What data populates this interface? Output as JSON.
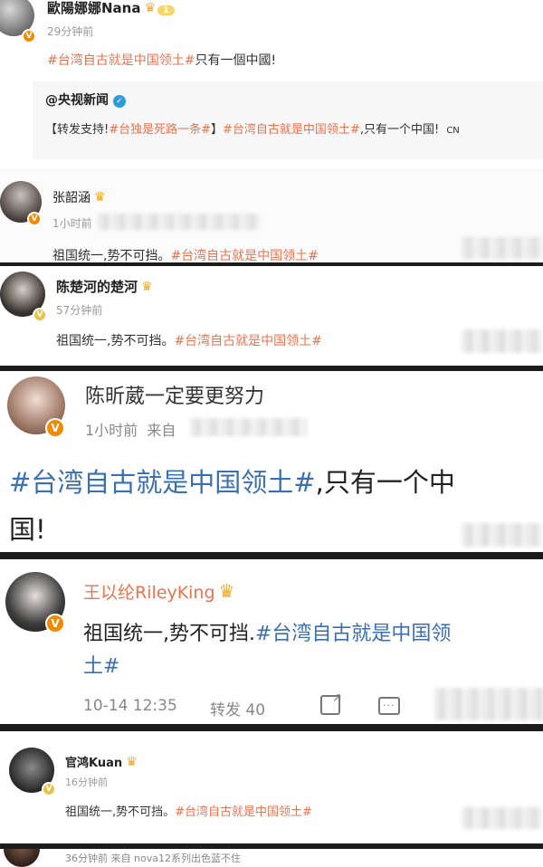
{
  "posts": [
    {
      "name": "歐陽娜娜Nana",
      "level": "1",
      "time": "29分钟前",
      "tag": "#台湾自古就是中国领土#",
      "text": "只有一個中國!",
      "quote": {
        "author": "@央视新闻",
        "prefix": "【转发支持!",
        "tag1": "#台独是死路一条#",
        "suffix": "】",
        "tag2": "#台湾自古就是中国领土#",
        "text": ",只有一个中国!",
        "flag": "CN"
      }
    },
    {
      "name": "张韶涵",
      "time": "1小时前",
      "text": "祖国统一,势不可挡。",
      "tag": "#台湾自古就是中国领土#"
    },
    {
      "name": "陈楚河的楚河",
      "time": "57分钟前",
      "text": "祖国统一,势不可挡。",
      "tag": "#台湾自古就是中国领土#"
    },
    {
      "name": "陈昕葳一定要更努力",
      "time": "1小时前",
      "source_prefix": "来自",
      "tag": "#台湾自古就是中国领土#",
      "text_line1": ",只有一个中",
      "text_line2": "国!"
    },
    {
      "name": "王以纶RileyKing",
      "text": "祖国统一,势不可挡.",
      "tag_line1": "#台湾自古就是中国领",
      "tag_line2": "土#",
      "date": "10-14 12:35",
      "repost_label": "转发",
      "repost_count": "40"
    },
    {
      "name": "官鸿Kuan",
      "time": "16分钟前",
      "text": "祖国统一,势不可挡。",
      "tag": "#台湾自古就是中国领土#"
    },
    {
      "meta": "36分钟前  来自 nova12系列出色蓝不住"
    }
  ],
  "icons": {
    "verified": "v-badge-icon",
    "crown": "crown-icon",
    "share": "share-icon",
    "comment": "comment-icon"
  },
  "colors": {
    "tag_orange": "#eb7350",
    "tag_blue": "#3a6fb0",
    "badge": "#f28a00"
  }
}
